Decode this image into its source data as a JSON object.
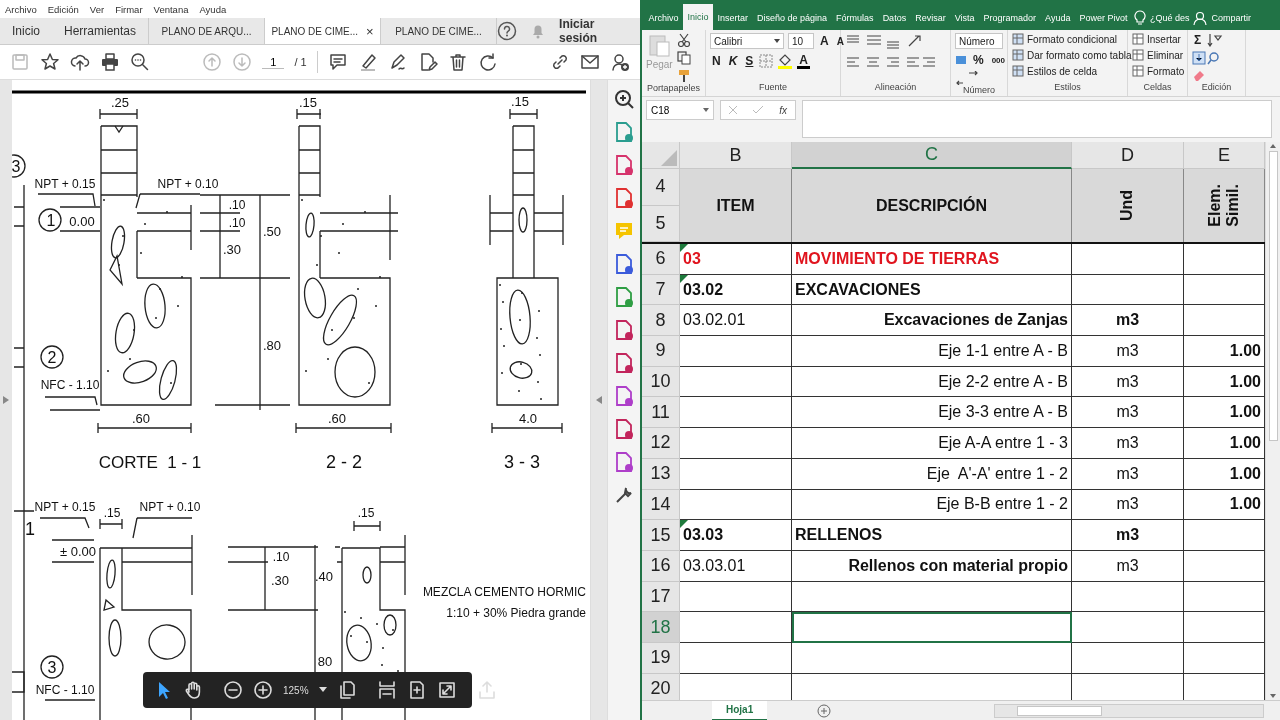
{
  "pdf_viewer": {
    "menu": [
      "Archivo",
      "Edición",
      "Ver",
      "Firmar",
      "Ventana",
      "Ayuda"
    ],
    "nav": [
      "Inicio",
      "Herramientas"
    ],
    "tabs": [
      {
        "label": "PLANO DE ARQU...",
        "selected": false
      },
      {
        "label": "PLANO DE CIME...",
        "selected": true
      },
      {
        "label": "PLANO DE CIME...",
        "selected": false
      }
    ],
    "tab_close": "×",
    "sign_in": "Iniciar sesión",
    "page_field": "1",
    "page_total": "/ 1",
    "drawing_labels": [
      ".25",
      ".15",
      ".15",
      "3",
      "NPT + 0.15",
      "NPT + 0.10",
      "1",
      "0.00",
      ".10",
      ".10",
      ".50",
      ".30",
      "2",
      "NFC - 1.10",
      ".80",
      ".60",
      ".60",
      "4.0",
      "CORTE  1 - 1",
      "2 - 2",
      "3 - 3",
      "NPT + 0.15",
      ".15",
      "NPT + 0.10",
      "1",
      "± 0.00",
      ".10",
      ".30",
      ".40",
      ".15",
      "MEZCLA CEMENTO HORMIC",
      "1:10 + 30% Piedra grande",
      "3",
      "NFC - 1.10",
      "80"
    ],
    "zoom_level": "125%"
  },
  "spreadsheet": {
    "tabs": [
      {
        "label": "Archivo",
        "selected": false
      },
      {
        "label": "Inicio",
        "selected": true
      },
      {
        "label": "Insertar",
        "selected": false
      },
      {
        "label": "Diseño de página",
        "selected": false
      },
      {
        "label": "Fórmulas",
        "selected": false
      },
      {
        "label": "Datos",
        "selected": false
      },
      {
        "label": "Revisar",
        "selected": false
      },
      {
        "label": "Vista",
        "selected": false
      },
      {
        "label": "Programador",
        "selected": false
      },
      {
        "label": "Ayuda",
        "selected": false
      },
      {
        "label": "Power Pivot",
        "selected": false
      }
    ],
    "search_hint": "¿Qué des",
    "share": "Compartir",
    "clipboard": {
      "paste": "Pegar",
      "label": "Portapapeles"
    },
    "font": {
      "name": "Calibri",
      "size": "10",
      "grow": "A",
      "shrink": "A",
      "bold": "N",
      "italic": "K",
      "underline": "S",
      "tint_button": "A",
      "label": "Fuente"
    },
    "alignment": {
      "label": "Alineación"
    },
    "number": {
      "format": "Número",
      "percent": "%",
      "thousands": "000",
      "label": "Número"
    },
    "styles": {
      "items": [
        "Formato condicional",
        "Dar formato como tabla",
        "Estilos de celda"
      ],
      "label": "Estilos"
    },
    "cells": {
      "items": [
        "Insertar",
        "Eliminar",
        "Formato"
      ],
      "label": "Celdas"
    },
    "editing": {
      "sum": "Σ",
      "label": "Edición"
    },
    "name_box": "C18",
    "fx": "fx",
    "columns": [
      {
        "label": "B",
        "selected": false
      },
      {
        "label": "C",
        "selected": true
      },
      {
        "label": "D",
        "selected": false
      },
      {
        "label": "E",
        "selected": false
      }
    ],
    "header": {
      "rows": [
        "4",
        "5"
      ],
      "item": "ITEM",
      "description": "DESCRIPCIÓN",
      "unit": "Und",
      "similar": "Elem.\nSimil."
    },
    "rows": [
      {
        "num": "6",
        "kind": "section",
        "item": "03",
        "description": "MOVIMIENTO DE TIERRAS",
        "flag": true,
        "selected": false
      },
      {
        "num": "7",
        "kind": "group",
        "item": "03.02",
        "description": "EXCAVACIONES",
        "flag": true,
        "selected": false
      },
      {
        "num": "8",
        "kind": "item",
        "item": "03.02.01",
        "description": "Excavaciones de Zanjas",
        "unit": "m3",
        "unit_bold": true,
        "flag": false,
        "selected": false
      },
      {
        "num": "9",
        "kind": "detail",
        "description": "Eje 1-1 entre A - B",
        "unit": "m3",
        "similar": "1.00",
        "flag": false,
        "selected": false
      },
      {
        "num": "10",
        "kind": "detail",
        "description": "Eje 2-2 entre A - B",
        "unit": "m3",
        "similar": "1.00",
        "flag": false,
        "selected": false
      },
      {
        "num": "11",
        "kind": "detail",
        "description": "Eje 3-3 entre A - B",
        "unit": "m3",
        "similar": "1.00",
        "flag": false,
        "selected": false
      },
      {
        "num": "12",
        "kind": "detail",
        "description": "Eje A-A entre 1 - 3",
        "unit": "m3",
        "similar": "1.00",
        "flag": false,
        "selected": false
      },
      {
        "num": "13",
        "kind": "detail",
        "description": "Eje  A'-A' entre 1 - 2",
        "unit": "m3",
        "similar": "1.00",
        "flag": false,
        "selected": false
      },
      {
        "num": "14",
        "kind": "detail",
        "description": "Eje B-B entre 1 - 2",
        "unit": "m3",
        "similar": "1.00",
        "flag": false,
        "selected": false
      },
      {
        "num": "15",
        "kind": "group",
        "item": "03.03",
        "description": "RELLENOS",
        "unit": "m3",
        "unit_bold": true,
        "flag": true,
        "selected": false
      },
      {
        "num": "16",
        "kind": "item",
        "item": "03.03.01",
        "description": "Rellenos con material propio",
        "unit": "m3",
        "unit_bold": false,
        "flag": false,
        "selected": false
      },
      {
        "num": "17",
        "kind": "detail",
        "flag": false,
        "selected": false
      },
      {
        "num": "18",
        "kind": "detail",
        "flag": false,
        "selected": true
      },
      {
        "num": "19",
        "kind": "detail",
        "flag": false,
        "selected": false
      },
      {
        "num": "20",
        "kind": "detail",
        "flag": false,
        "selected": false
      }
    ],
    "sheets": [
      {
        "label": "Hoja1",
        "selected": true
      }
    ]
  }
}
